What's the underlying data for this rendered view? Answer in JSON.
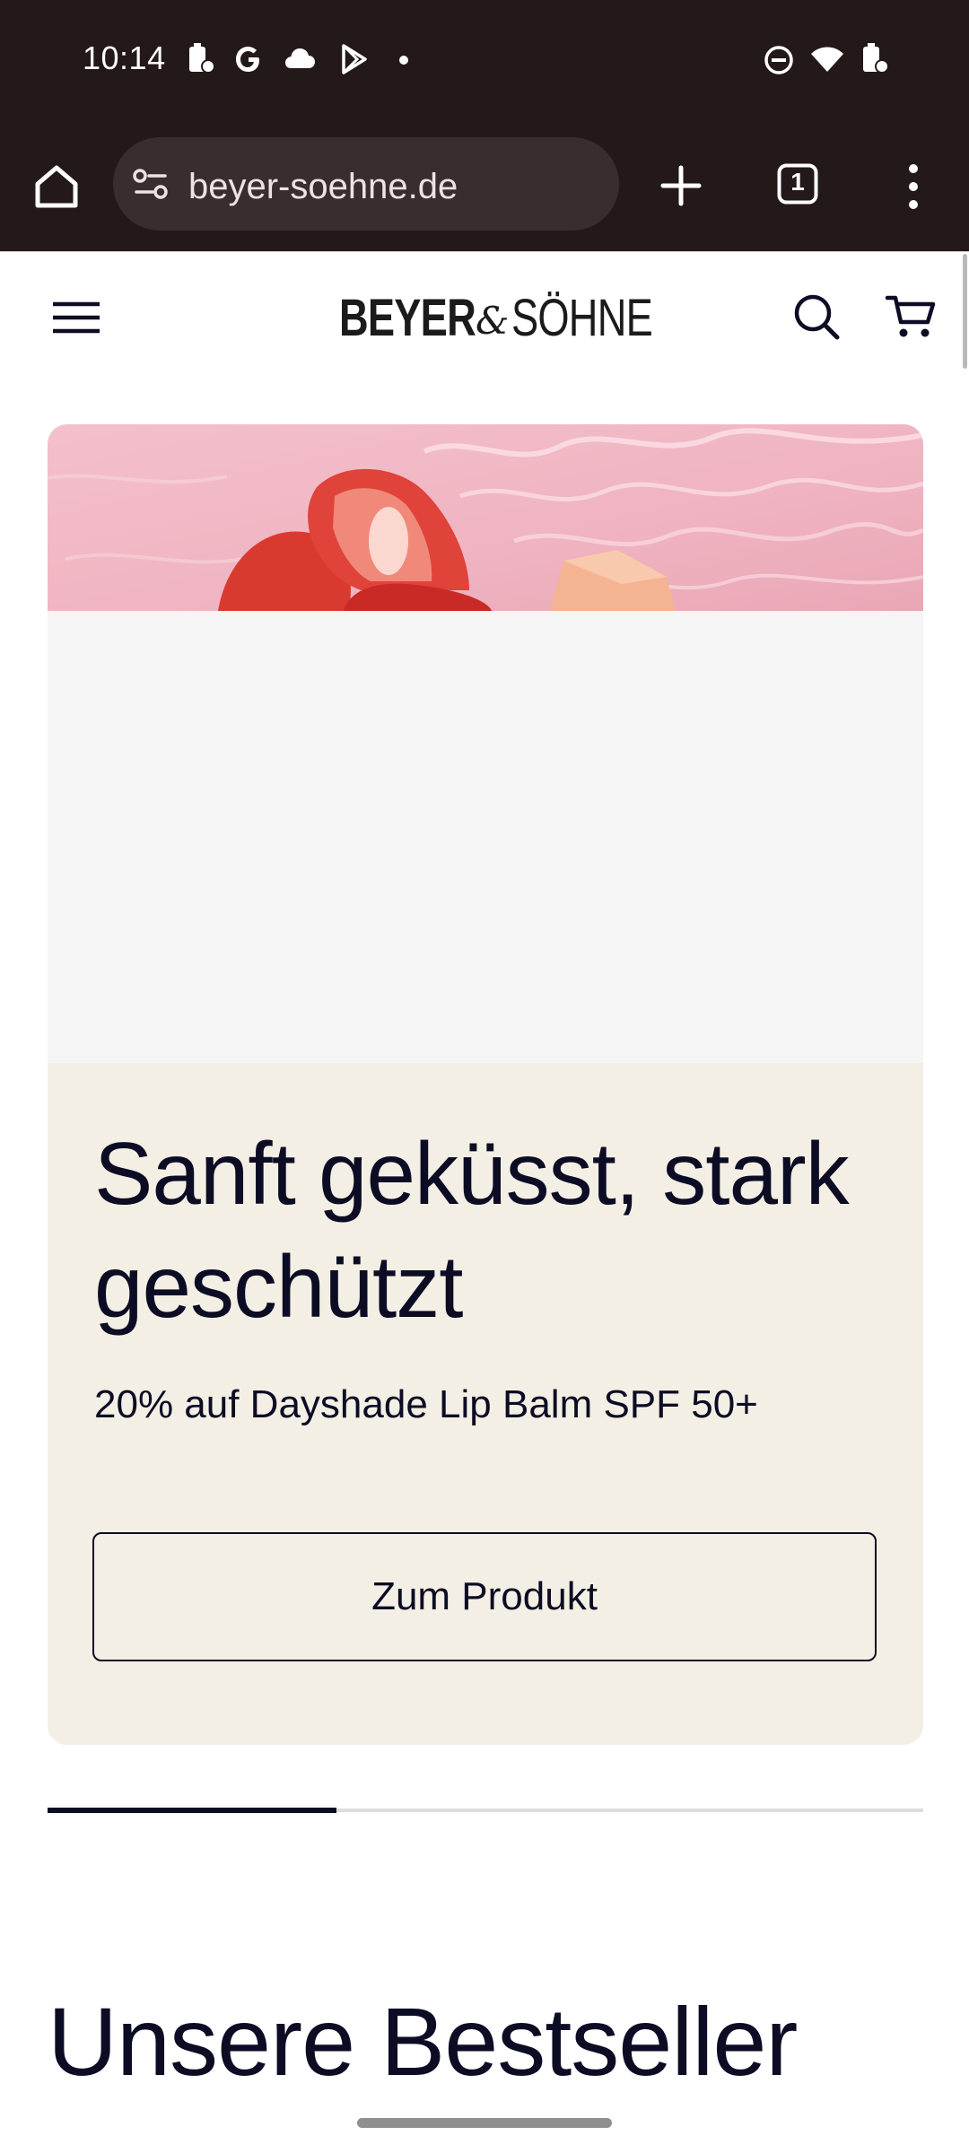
{
  "status_bar": {
    "time": "10:14",
    "left_icons": [
      "battery-saver-icon",
      "google-icon",
      "cloud-icon",
      "play-store-icon",
      "dot-icon"
    ],
    "right_icons": [
      "do-not-disturb-icon",
      "wifi-icon",
      "battery-icon"
    ]
  },
  "browser": {
    "url": "beyer-soehne.de",
    "tab_count": "1",
    "icons": [
      "home-icon",
      "site-settings-icon",
      "new-tab-icon",
      "tab-switcher-icon",
      "more-menu-icon"
    ]
  },
  "site_header": {
    "logo": {
      "part1": "BEYER",
      "amp": "&",
      "part2": "SÖHNE"
    },
    "icons": [
      "hamburger-menu-icon",
      "search-icon",
      "cart-icon"
    ]
  },
  "hero": {
    "title": "Sanft geküsst, stark geschützt",
    "subtitle": "20% auf Dayshade Lip Balm SPF 50+",
    "button_label": "Zum Produkt",
    "slide_progress": 0.33
  },
  "bestsellers": {
    "heading": "Unsere Bestseller"
  },
  "colors": {
    "browser_chrome": "#231919",
    "url_pill": "#3a2d2d",
    "text_dark": "#0c0c24",
    "hero_beige": "#f4efe5",
    "placeholder_gray": "#f6f5f5",
    "image_pink": "#f1b7c4",
    "strawberry_red": "#e0433a"
  }
}
